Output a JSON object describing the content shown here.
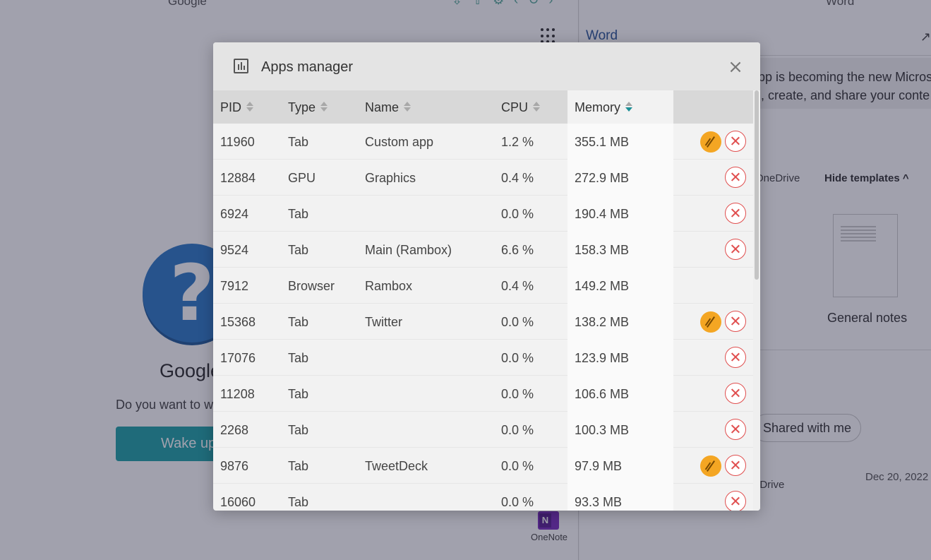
{
  "background": {
    "top_left_label": "Google",
    "top_right_label": "Word",
    "word_title": "Word",
    "banner_line1": "pp is becoming the new Micros",
    "banner_line2": "l, create, and share your conte",
    "onedrive_label": "OneDrive",
    "hide_templates": "Hide templates ^",
    "template_name": "General notes",
    "shared_with_me": "Shared with me",
    "onedrive_label_2": "eDrive",
    "date": "Dec 20, 2022",
    "google_title": "Google",
    "google_desc": "Do you want to w",
    "wake_button": "Wake up",
    "onenote_label": "OneNote",
    "onenote_letter": "N",
    "question_mark": "?"
  },
  "modal": {
    "title": "Apps manager",
    "close_symbol": "×",
    "columns": {
      "pid": "PID",
      "type": "Type",
      "name": "Name",
      "cpu": "CPU",
      "memory": "Memory"
    },
    "sorted_column": "Memory",
    "sort_direction": "descending",
    "rows": [
      {
        "pid": "11960",
        "type": "Tab",
        "name": "Custom app",
        "cpu": "1.2 %",
        "memory": "355.1 MB",
        "sleep": true,
        "kill": true
      },
      {
        "pid": "12884",
        "type": "GPU",
        "name": "Graphics",
        "cpu": "0.4 %",
        "memory": "272.9 MB",
        "sleep": false,
        "kill": true
      },
      {
        "pid": "6924",
        "type": "Tab",
        "name": "",
        "cpu": "0.0 %",
        "memory": "190.4 MB",
        "sleep": false,
        "kill": true
      },
      {
        "pid": "9524",
        "type": "Tab",
        "name": "Main (Rambox)",
        "cpu": "6.6 %",
        "memory": "158.3 MB",
        "sleep": false,
        "kill": true
      },
      {
        "pid": "7912",
        "type": "Browser",
        "name": "Rambox",
        "cpu": "0.4 %",
        "memory": "149.2 MB",
        "sleep": false,
        "kill": false
      },
      {
        "pid": "15368",
        "type": "Tab",
        "name": "Twitter",
        "cpu": "0.0 %",
        "memory": "138.2 MB",
        "sleep": true,
        "kill": true
      },
      {
        "pid": "17076",
        "type": "Tab",
        "name": "",
        "cpu": "0.0 %",
        "memory": "123.9 MB",
        "sleep": false,
        "kill": true
      },
      {
        "pid": "11208",
        "type": "Tab",
        "name": "",
        "cpu": "0.0 %",
        "memory": "106.6 MB",
        "sleep": false,
        "kill": true
      },
      {
        "pid": "2268",
        "type": "Tab",
        "name": "",
        "cpu": "0.0 %",
        "memory": "100.3 MB",
        "sleep": false,
        "kill": true
      },
      {
        "pid": "9876",
        "type": "Tab",
        "name": "TweetDeck",
        "cpu": "0.0 %",
        "memory": "97.9 MB",
        "sleep": true,
        "kill": true
      },
      {
        "pid": "16060",
        "type": "Tab",
        "name": "",
        "cpu": "0.0 %",
        "memory": "93.3 MB",
        "sleep": false,
        "kill": true
      }
    ]
  },
  "colors": {
    "overlay": "#1e1e3c",
    "accent_teal": "#1fa3a8",
    "sleep_orange": "#f4a623",
    "kill_red": "#e04e4e",
    "word_blue": "#2b579a"
  }
}
